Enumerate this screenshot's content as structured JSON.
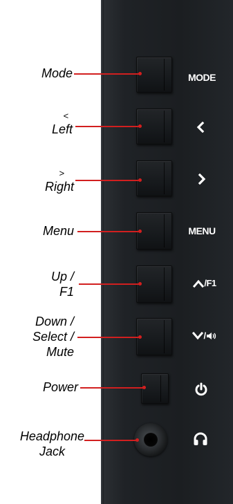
{
  "callouts": {
    "mode": {
      "text": "Mode"
    },
    "left": {
      "line1": "<",
      "line2": "Left"
    },
    "right": {
      "line1": ">",
      "line2": "Right"
    },
    "menu": {
      "text": "Menu"
    },
    "up": {
      "line1": "Up /",
      "line2": "F1"
    },
    "down": {
      "line1": "Down /",
      "line2": "Select /",
      "line3": "Mute"
    },
    "power": {
      "text": "Power"
    },
    "headphone": {
      "line1": "Headphone",
      "line2": "Jack"
    }
  },
  "panel_labels": {
    "mode": "MODE",
    "menu": "MENU",
    "up_f1": "/F1"
  },
  "icons": {
    "left": "chevron-left-icon",
    "right": "chevron-right-icon",
    "up": "chevron-up-icon",
    "down": "chevron-down-icon",
    "speaker": "speaker-icon",
    "power": "power-icon",
    "headphones": "headphones-icon"
  },
  "colors": {
    "leader_line": "#d21f1f",
    "panel": "#1c1f22",
    "panel_text": "#ffffff",
    "callout_text": "#000000"
  }
}
